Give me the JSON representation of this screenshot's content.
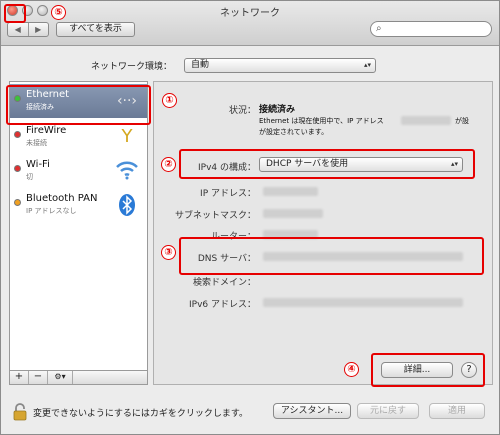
{
  "window": {
    "title": "ネットワーク"
  },
  "toolbar": {
    "back_label": "◀",
    "forward_label": "▶",
    "show_all_label": "すべてを表示",
    "search_placeholder": ""
  },
  "location": {
    "label": "ネットワーク環境：",
    "value": "自動"
  },
  "sidebar": {
    "items": [
      {
        "name": "Ethernet",
        "status": "接続済み",
        "dot_color": "#3cc23c",
        "icon": "ethernet-icon",
        "selected": true
      },
      {
        "name": "FireWire",
        "status": "未接続",
        "dot_color": "#e03030",
        "icon": "firewire-icon"
      },
      {
        "name": "Wi-Fi",
        "status": "切",
        "dot_color": "#e03030",
        "icon": "wifi-icon"
      },
      {
        "name": "Bluetooth PAN",
        "status": "IP アドレスなし",
        "dot_color": "#f0a020",
        "icon": "bluetooth-icon"
      }
    ],
    "bottom": {
      "add": "+",
      "remove": "−",
      "gear": "⚙▾"
    }
  },
  "detail": {
    "status_label": "状況：",
    "status_value": "接続済み",
    "status_desc": "Ethernet は現在使用中で、IP アドレス",
    "status_desc_end": "が設定されています。",
    "ipv4_label": "IPv4 の構成：",
    "ipv4_value": "DHCP サーバを使用",
    "ip_label": "IP アドレス：",
    "subnet_label": "サブネットマスク：",
    "router_label": "ルーター：",
    "dns_label": "DNS サーバ：",
    "search_domain_label": "検索ドメイン：",
    "ipv6_label": "IPv6 アドレス：",
    "advanced_label": "詳細...",
    "help_label": "?"
  },
  "footer": {
    "lock_text": "変更できないようにするにはカギをクリックします。",
    "assistant_label": "アシスタント...",
    "revert_label": "元に戻す",
    "apply_label": "適用"
  },
  "annotations": {
    "n1": "①",
    "n2": "②",
    "n3": "③",
    "n4": "④",
    "n5": "⑤"
  },
  "colors": {
    "highlight_red": "#e60000",
    "selected_row": "#7a8aa6"
  }
}
